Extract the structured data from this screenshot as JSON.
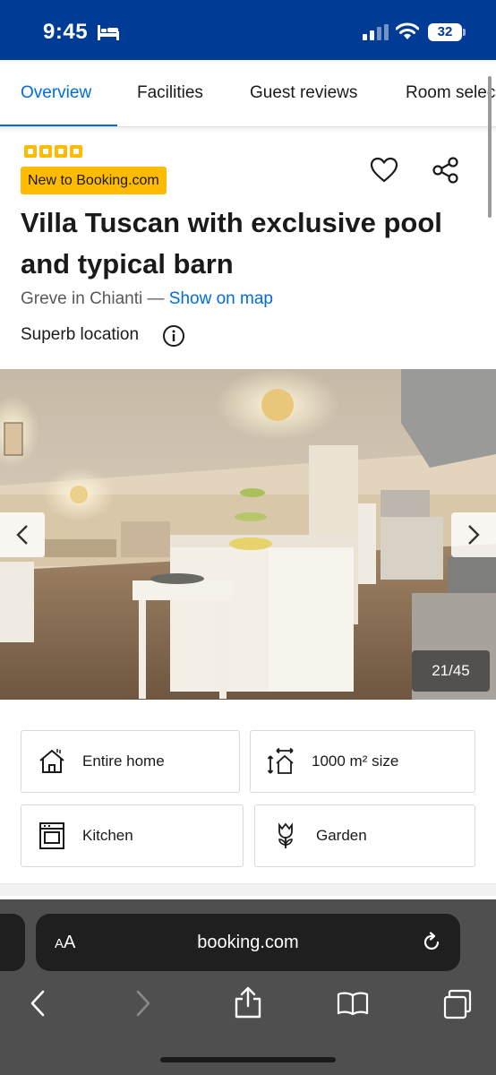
{
  "status_bar": {
    "time": "9:45",
    "battery": "32"
  },
  "tabs": [
    {
      "label": "Overview",
      "active": true
    },
    {
      "label": "Facilities",
      "active": false
    },
    {
      "label": "Guest reviews",
      "active": false
    },
    {
      "label": "Room selec",
      "active": false
    }
  ],
  "property": {
    "star_rating": 4,
    "badge": "New to Booking.com",
    "title": "Villa Tuscan with exclusive pool and typical barn",
    "location": "Greve in Chianti",
    "location_separator": " — ",
    "map_link": "Show on map",
    "highlight": "Superb location"
  },
  "gallery": {
    "counter": "21/45",
    "current": 21,
    "total": 45
  },
  "facilities": [
    {
      "label": "Entire home",
      "icon": "house-icon"
    },
    {
      "label": "1000 m² size",
      "icon": "size-icon"
    },
    {
      "label": "Kitchen",
      "icon": "oven-icon"
    },
    {
      "label": "Garden",
      "icon": "flower-icon"
    }
  ],
  "browser": {
    "text_size_button": "AA",
    "url": "booking.com"
  },
  "colors": {
    "brand_blue": "#003b95",
    "link_blue": "#006ce4",
    "badge_yellow": "#febb02"
  }
}
